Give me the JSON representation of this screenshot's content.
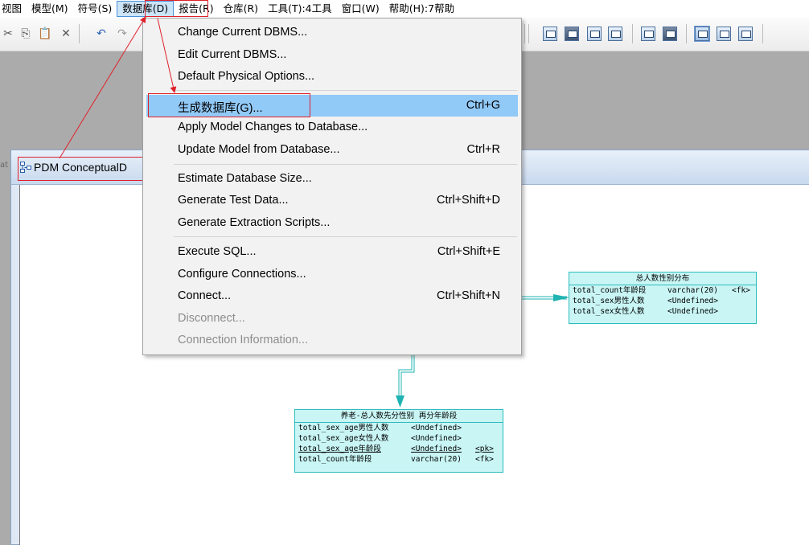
{
  "menubar": {
    "items": [
      {
        "label": "视图"
      },
      {
        "label": "模型(M)"
      },
      {
        "label": "符号(S)"
      },
      {
        "label": "数据库(D)"
      },
      {
        "label": "报告(R)"
      },
      {
        "label": "仓库(R)"
      },
      {
        "label": "工具(T):4工具"
      },
      {
        "label": "窗口(W)"
      },
      {
        "label": "帮助(H):7帮助"
      }
    ]
  },
  "toolbar": {
    "left_glyphs": [
      "✂",
      "⎘",
      "📋",
      "✕",
      "↶",
      "↷"
    ]
  },
  "window": {
    "title": "PDM ConceptualD",
    "left_cut_text": "at"
  },
  "dropdown": {
    "items": [
      {
        "label": "Change Current DBMS...",
        "accel": ""
      },
      {
        "label": "Edit Current DBMS...",
        "accel": ""
      },
      {
        "label": "Default Physical Options...",
        "accel": ""
      },
      {
        "label": "生成数据库(G)...",
        "accel": "Ctrl+G"
      },
      {
        "label": "Apply Model Changes to Database...",
        "accel": ""
      },
      {
        "label": "Update Model from Database...",
        "accel": "Ctrl+R"
      },
      {
        "label": "Estimate Database Size...",
        "accel": ""
      },
      {
        "label": "Generate Test Data...",
        "accel": "Ctrl+Shift+D"
      },
      {
        "label": "Generate Extraction Scripts...",
        "accel": ""
      },
      {
        "label": "Execute SQL...",
        "accel": "Ctrl+Shift+E"
      },
      {
        "label": "Configure Connections...",
        "accel": ""
      },
      {
        "label": "Connect...",
        "accel": "Ctrl+Shift+N"
      },
      {
        "label": "Disconnect...",
        "accel": ""
      },
      {
        "label": "Connection Information...",
        "accel": ""
      }
    ]
  },
  "tables": {
    "t1": {
      "name": "总人数性别分布",
      "rows": [
        {
          "col": "total_count年龄段",
          "type": "varchar(20)",
          "key": "<fk>"
        },
        {
          "col": "total_sex男性人数",
          "type": "<Undefined>",
          "key": ""
        },
        {
          "col": "total_sex女性人数",
          "type": "<Undefined>",
          "key": ""
        }
      ]
    },
    "t2": {
      "name": "养老-总人数先分性别 再分年龄段",
      "rows": [
        {
          "col": "total_sex_age男性人数",
          "type": "<Undefined>",
          "key": ""
        },
        {
          "col": "total_sex_age女性人数",
          "type": "<Undefined>",
          "key": ""
        },
        {
          "col": "total_sex_age年龄段",
          "type": "<Undefined>",
          "key": "<pk>"
        },
        {
          "col": "total_count年龄段",
          "type": "varchar(20)",
          "key": "<fk>"
        }
      ]
    }
  },
  "colors": {
    "annotation_red": "#e0202a",
    "menu_highlight": "#91c9f7",
    "table_fill": "#c9f5f5",
    "table_border": "#2dbcbc"
  }
}
